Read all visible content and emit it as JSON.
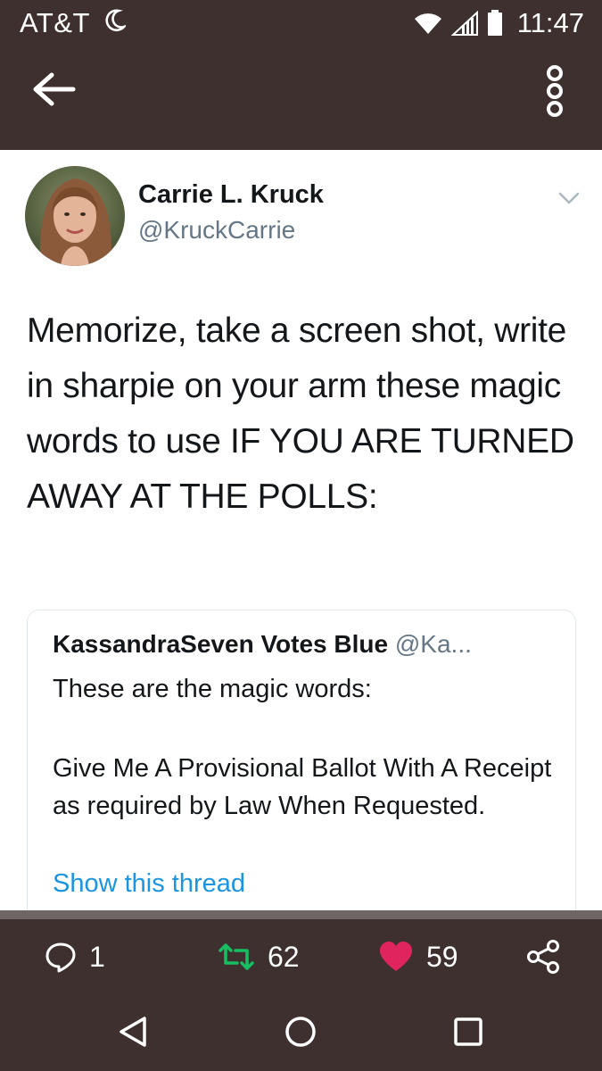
{
  "status_bar": {
    "carrier": "AT&T",
    "time": "11:47",
    "icons": [
      "moon-icon",
      "wifi-icon",
      "signal-icon",
      "battery-icon"
    ]
  },
  "app_bar": {
    "icons": [
      "back-arrow-icon",
      "more-vertical-icon"
    ]
  },
  "tweet": {
    "author_name": "Carrie L. Kruck",
    "author_handle": "@KruckCarrie",
    "text": "Memorize, take a screen shot, write in sharpie on your arm these magic words to use IF YOU ARE TURNED AWAY AT THE POLLS:",
    "quote": {
      "author_name": "KassandraSeven Votes Blue",
      "author_handle": "@Ka...",
      "line1": "These are the magic words:",
      "body": "Give Me A Provisional Ballot With A Receipt as required by Law When Requested.",
      "show_thread": "Show this thread"
    }
  },
  "actions": {
    "replies": "1",
    "retweets": "62",
    "likes": "59",
    "colors": {
      "retweet": "#17bf63",
      "like": "#e0245e"
    }
  },
  "nav": {
    "icons": [
      "back-triangle-icon",
      "home-circle-icon",
      "recents-square-icon"
    ]
  }
}
